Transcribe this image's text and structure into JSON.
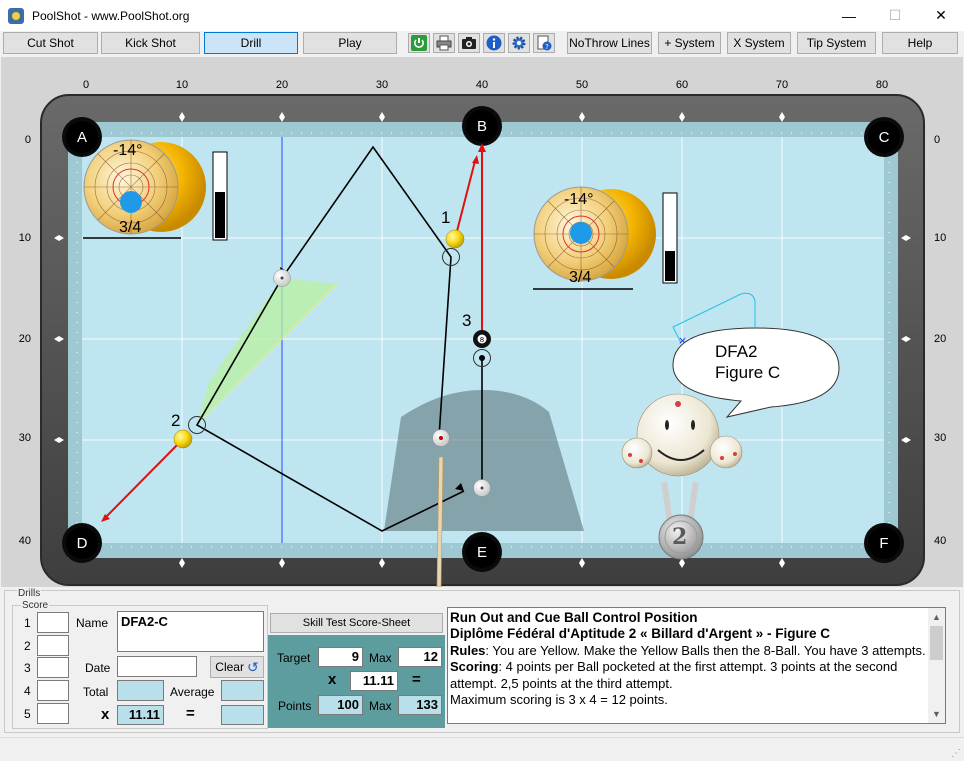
{
  "window": {
    "title": "PoolShot - www.PoolShot.org",
    "minimize_glyph": "—",
    "maximize_glyph": "☐",
    "close_glyph": "✕"
  },
  "toolbar": {
    "cut_shot": "Cut Shot",
    "kick_shot": "Kick Shot",
    "drill": "Drill",
    "play": "Play",
    "nothrow_lines": "NoThrow Lines",
    "plus_system": "+ System",
    "x_system": "X System",
    "tip_system": "Tip System",
    "help": "Help",
    "icons": [
      "power-icon",
      "printer-icon",
      "camera-icon",
      "info-icon",
      "gear-icon",
      "help-page-icon"
    ],
    "active_tab": "drill"
  },
  "table": {
    "x_axis_labels": [
      "0",
      "10",
      "20",
      "30",
      "40",
      "50",
      "60",
      "70",
      "80"
    ],
    "y_axis_labels": [
      "0",
      "10",
      "20",
      "30",
      "40"
    ],
    "pockets": [
      "A",
      "B",
      "C",
      "D",
      "E",
      "F"
    ],
    "ball_numbers": [
      "1",
      "2",
      "3"
    ],
    "cue_tip_left": {
      "angle": "-14°",
      "fraction": "3/4"
    },
    "cue_tip_right": {
      "angle": "-14°",
      "fraction": "3/4"
    },
    "power_left": 0.55,
    "power_right": 0.35,
    "speech_bubble": {
      "line1": "DFA2",
      "line2": "Figure C"
    },
    "medal": "2",
    "colors": {
      "cloth": "#bfe6f0",
      "rail": "#5a5a5a",
      "yellow_ball": "#f8dc1a",
      "aim_line": "#000000",
      "pocket_line": "#e01010",
      "zone": "#b8f0a0"
    }
  },
  "drills": {
    "legend": "Drills",
    "score_legend": "Score",
    "row_numbers": [
      "1",
      "2",
      "3",
      "4",
      "5"
    ],
    "name_label": "Name",
    "name_value": "DFA2-C",
    "date_label": "Date",
    "clear_label": "Clear",
    "total_label": "Total",
    "average_label": "Average",
    "x_label": "x",
    "eq_label": "=",
    "multiplier": "11.11",
    "skill_sheet": "Skill Test Score-Sheet",
    "target_label": "Target",
    "target_value": "9",
    "max_label": "Max",
    "max_value": "12",
    "mult_value": "11.11",
    "points_label": "Points",
    "points_value": "100",
    "points_max_label": "Max",
    "points_max_value": "133"
  },
  "description": {
    "title": "Run Out and Cue Ball Control Position",
    "subtitle": "Diplôme Fédéral d'Aptitude 2 « Billard d'Argent » - Figure C",
    "rules_label": "Rules",
    "rules_text": ": You are Yellow. Make the Yellow Balls then the 8-Ball. You have 3 attempts.",
    "scoring_label": "Scoring",
    "scoring_text": ": 4 points per Ball pocketed at the first attempt. 3 points at the second attempt. 2,5 points at the third attempt.",
    "max_text": "Maximum scoring is 3 x 4 = 12 points."
  }
}
